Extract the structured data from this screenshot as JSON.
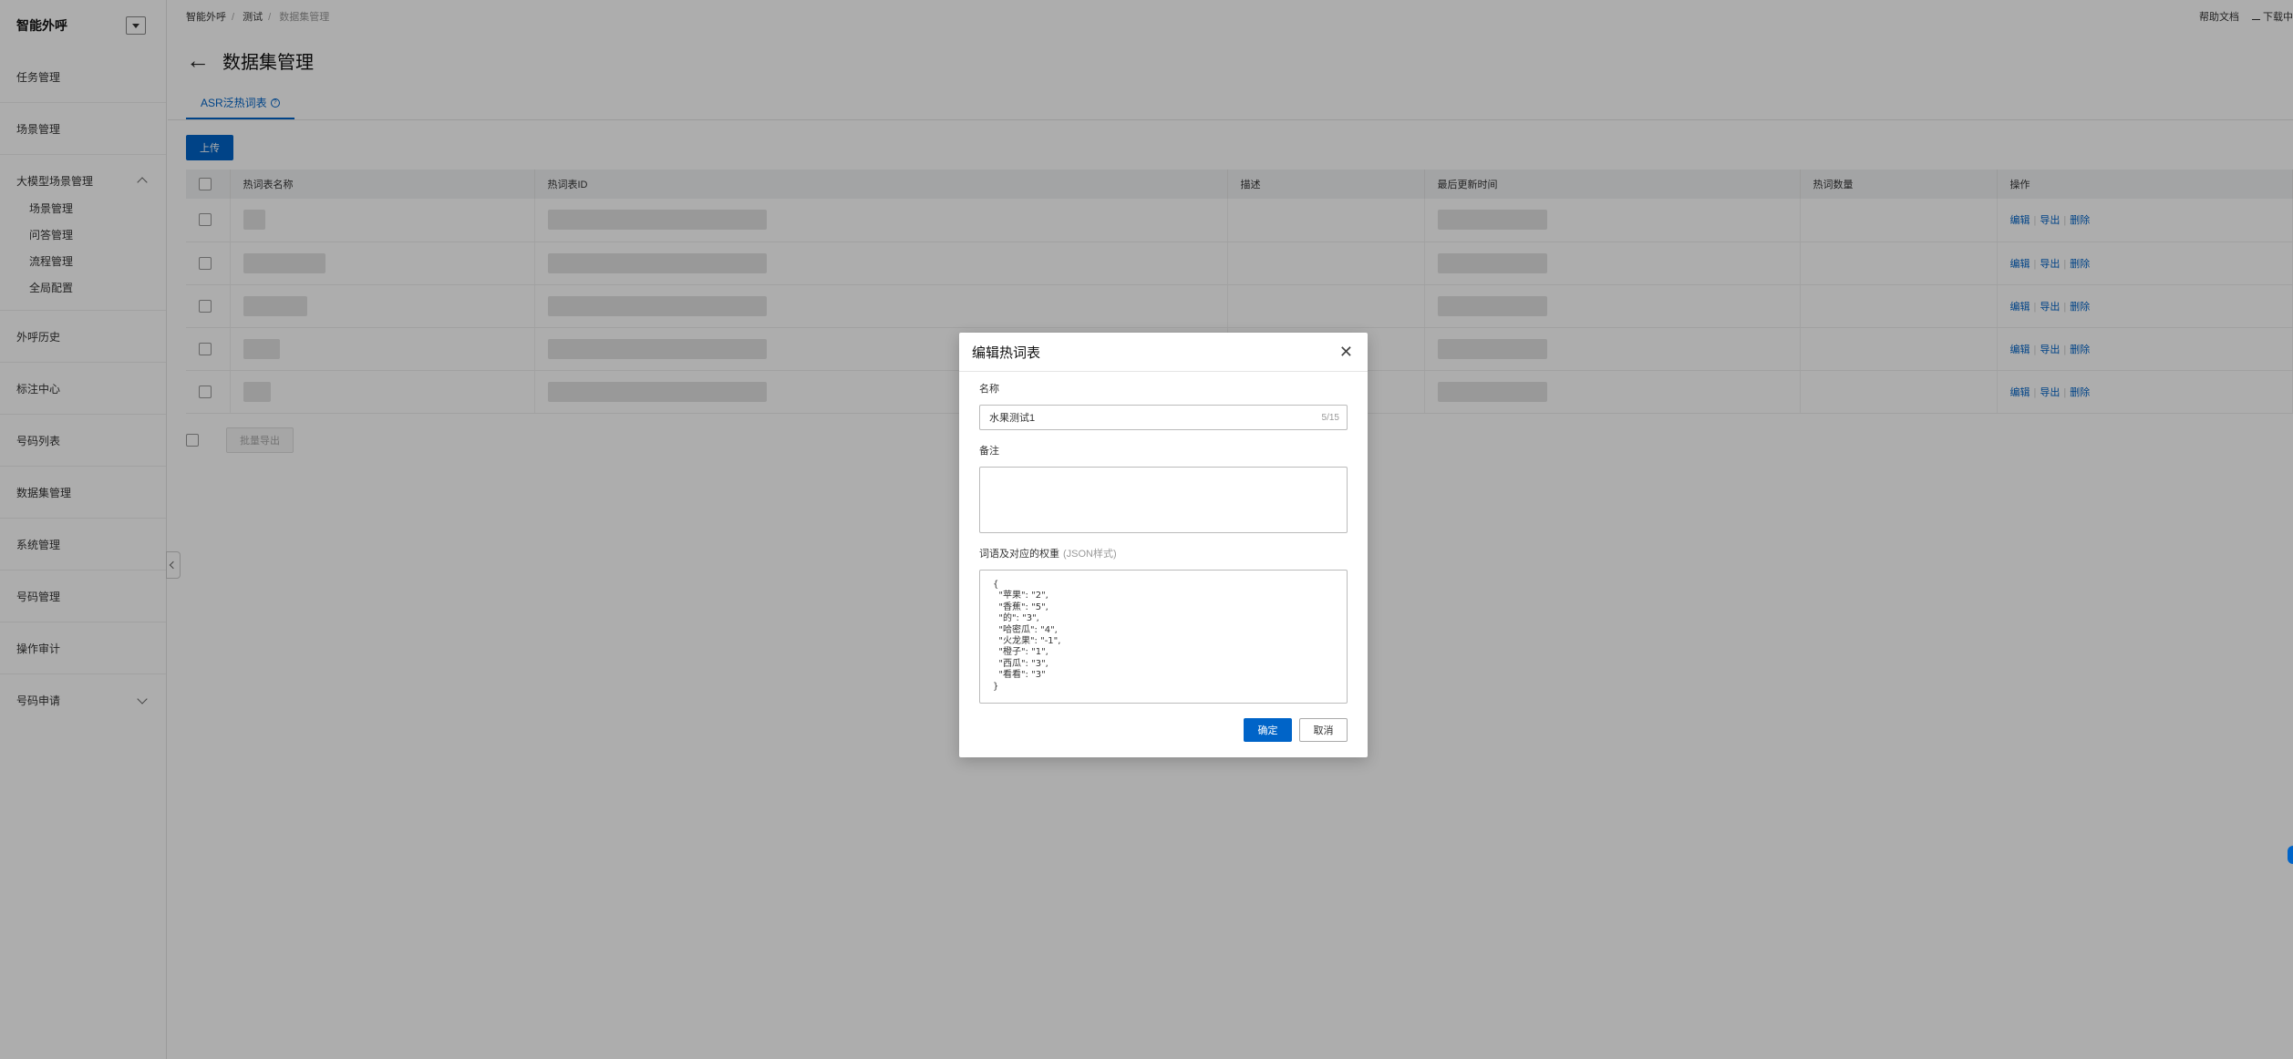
{
  "sidebar": {
    "title": "智能外呼",
    "items": [
      "任务管理",
      "场景管理"
    ],
    "group": {
      "label": "大模型场景管理",
      "children": [
        "场景管理",
        "问答管理",
        "流程管理",
        "全局配置"
      ]
    },
    "items2": [
      "外呼历史",
      "标注中心",
      "号码列表",
      "数据集管理",
      "系统管理",
      "号码管理",
      "操作审计"
    ],
    "last_group": "号码申请"
  },
  "breadcrumb": [
    "智能外呼",
    "测试",
    "数据集管理"
  ],
  "top_links": {
    "help": "帮助文档",
    "download": "下载中"
  },
  "page_title": "数据集管理",
  "tab": "ASR泛热词表",
  "upload_label": "上传",
  "table": {
    "columns": [
      "热词表名称",
      "热词表ID",
      "描述",
      "最后更新时间",
      "热词数量",
      "操作"
    ],
    "ops": [
      "编辑",
      "导出",
      "删除"
    ],
    "row_count": 5
  },
  "batch_export": "批量导出",
  "modal": {
    "title": "编辑热词表",
    "name_label": "名称",
    "name_value": "水果测试1",
    "name_count": "5/15",
    "remark_label": "备注",
    "weights_label": "词语及对应的权重",
    "weights_hint": "(JSON样式)",
    "weights_value": "{\n  \"苹果\": \"2\",\n  \"香蕉\": \"5\",\n  \"的\": \"3\",\n  \"哈密瓜\": \"4\",\n  \"火龙果\": \"-1\",\n  \"橙子\": \"1\",\n  \"西瓜\": \"3\",\n  \"看看\": \"3\"\n}",
    "ok": "确定",
    "cancel": "取消"
  }
}
